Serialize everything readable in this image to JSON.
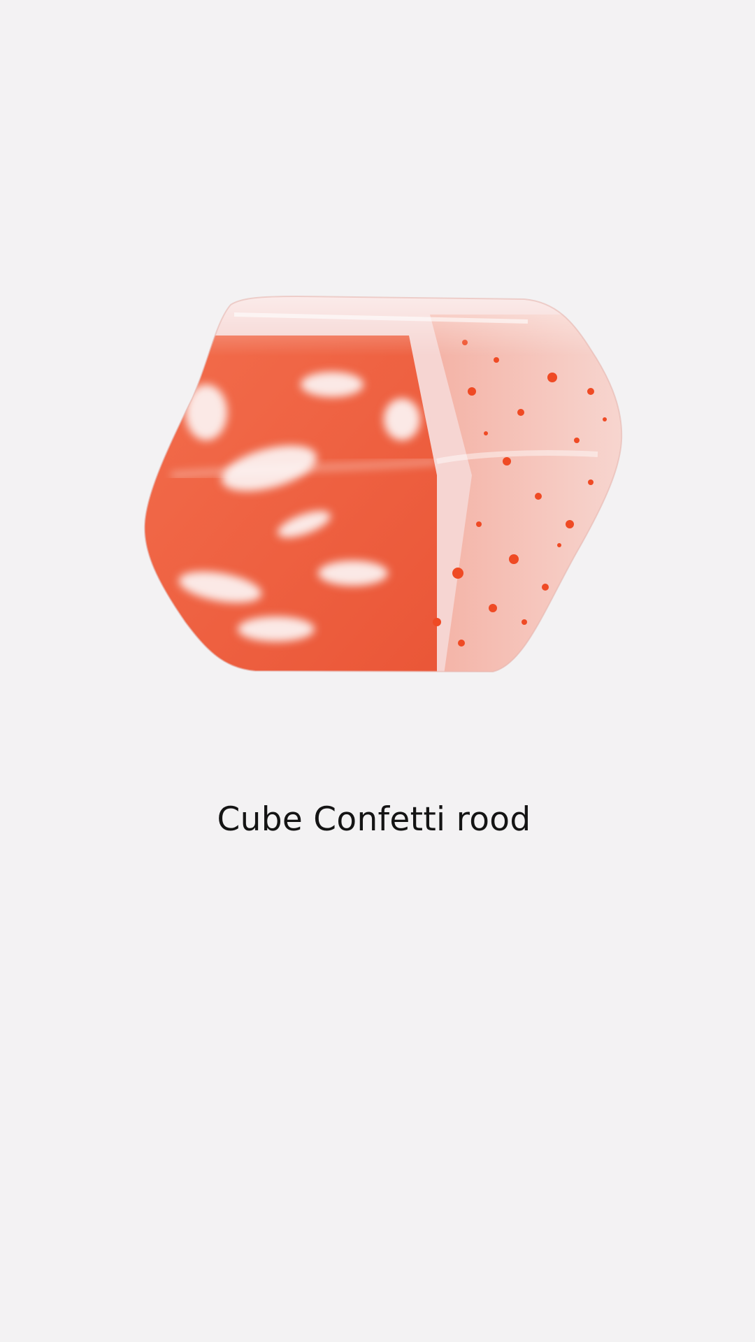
{
  "product": {
    "title": "Cube Confetti rood",
    "image_subject": "red-white confetti cube bead",
    "colors": {
      "background": "#f3f2f3",
      "base": "#f6d5d2",
      "accent": "#ee3f1c",
      "title_text": "#141414"
    }
  }
}
